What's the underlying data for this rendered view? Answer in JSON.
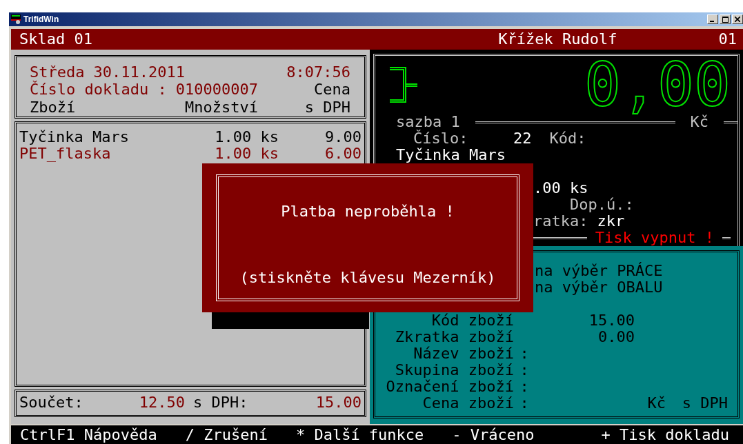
{
  "window": {
    "title": "TrifidWin"
  },
  "header": {
    "store": "Sklad 01",
    "cashier": "Křížek Rudolf",
    "register": "01"
  },
  "receipt": {
    "day": "Středa",
    "date": "30.11.2011",
    "time": "8:07:56",
    "doc_label": "Číslo dokladu :",
    "doc_number": "010000007",
    "price_heading": "Cena",
    "columns": [
      "Zboží",
      "Množství",
      "s DPH"
    ],
    "items": [
      {
        "name": "Tyčinka Mars",
        "qty": "1.00 ks",
        "price": "9.00",
        "selected": false
      },
      {
        "name": "PET_flaska",
        "qty": "1.00 ks",
        "price": "6.00",
        "selected": true
      }
    ],
    "total": {
      "label": "Součet:",
      "net": "12.50",
      "vat_label": "s DPH:",
      "gross": "15.00"
    }
  },
  "display": {
    "amount": "0,00",
    "rate_label": "sazba 1",
    "currency": "Kč",
    "number_label": "Číslo:",
    "number": "22",
    "code_label": "Kód:",
    "item_name": "Tyčinka Mars",
    "qty": ".00 ks",
    "extra_label": "Dop.ú.:",
    "short_label": "ratka:",
    "short_value": "zkr",
    "print_status": "Tisk vypnut !"
  },
  "lookup": {
    "options": [
      "na výběr PRÁCE",
      "na výběr OBALU"
    ],
    "fields": [
      {
        "label": "Kód zboží",
        "value": "15.00"
      },
      {
        "label": "Zkratka zboží",
        "value": "0.00"
      },
      {
        "label": "Název zboží",
        "separator": ":"
      },
      {
        "label": "Skupina zboží",
        "separator": ":"
      },
      {
        "label": "Označení zboží",
        "separator": ":"
      },
      {
        "label": "Cena zboží",
        "separator": ":",
        "currency": "Kč",
        "note": "s DPH"
      }
    ]
  },
  "dialog": {
    "message": "Platba neproběhla !",
    "hint": "(stiskněte klávesu Mezerník)"
  },
  "footer": [
    "CtrlF1 Nápověda",
    "/ Zrušení",
    "* Další funkce",
    "- Vráceno",
    "+ Tisk dokladu"
  ]
}
